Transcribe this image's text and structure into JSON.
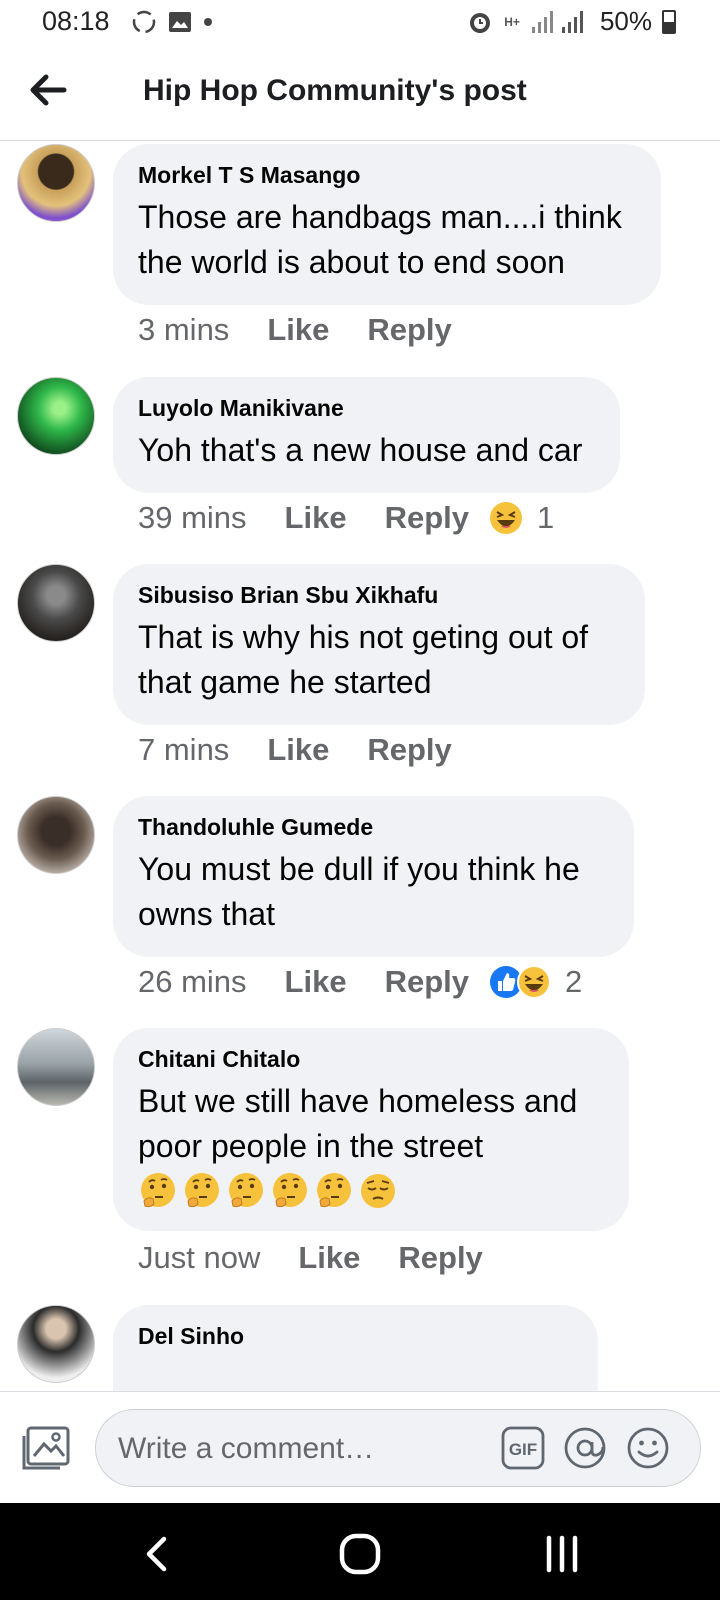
{
  "status_bar": {
    "time": "08:18",
    "network": "H+",
    "battery": "50%"
  },
  "header": {
    "title": "Hip Hop Community's post"
  },
  "comments": [
    {
      "author": "Morkel T S Masango",
      "lines": [
        "Those are handbags man....i think",
        "the world is about to end soon"
      ],
      "time": "3 mins",
      "like": "Like",
      "reply": "Reply"
    },
    {
      "author": "Luyolo Manikivane",
      "lines": [
        "Yoh that's a new house and car"
      ],
      "time": "39 mins",
      "like": "Like",
      "reply": "Reply",
      "reactions": [
        "laughing-emoji"
      ],
      "reaction_count": "1"
    },
    {
      "author": "Sibusiso Brian Sbu Xikhafu",
      "lines": [
        "That is why his not geting out of",
        "that game he started"
      ],
      "time": "7 mins",
      "like": "Like",
      "reply": "Reply"
    },
    {
      "author": "Thandoluhle Gumede",
      "lines": [
        "You must be dull if you think he",
        "owns that"
      ],
      "time": "26 mins",
      "like": "Like",
      "reply": "Reply",
      "reactions": [
        "like-reaction",
        "laughing-emoji"
      ],
      "reaction_count": "2"
    },
    {
      "author": "Chitani Chitalo",
      "lines": [
        "But we still have homeless and",
        "poor people in the street"
      ],
      "emojis": [
        "thinking-face",
        "thinking-face",
        "thinking-face",
        "thinking-face",
        "thinking-face",
        "pensive-face"
      ],
      "time": "Just now",
      "like": "Like",
      "reply": "Reply"
    },
    {
      "author": "Del Sinho"
    }
  ],
  "composer": {
    "placeholder": "Write a comment…",
    "gif_label": "GIF"
  },
  "colors": {
    "bubble": "#f0f2f5",
    "meta_text": "#65676b",
    "like_blue": "#1877f2",
    "emoji_yellow": "#f7c23b"
  }
}
